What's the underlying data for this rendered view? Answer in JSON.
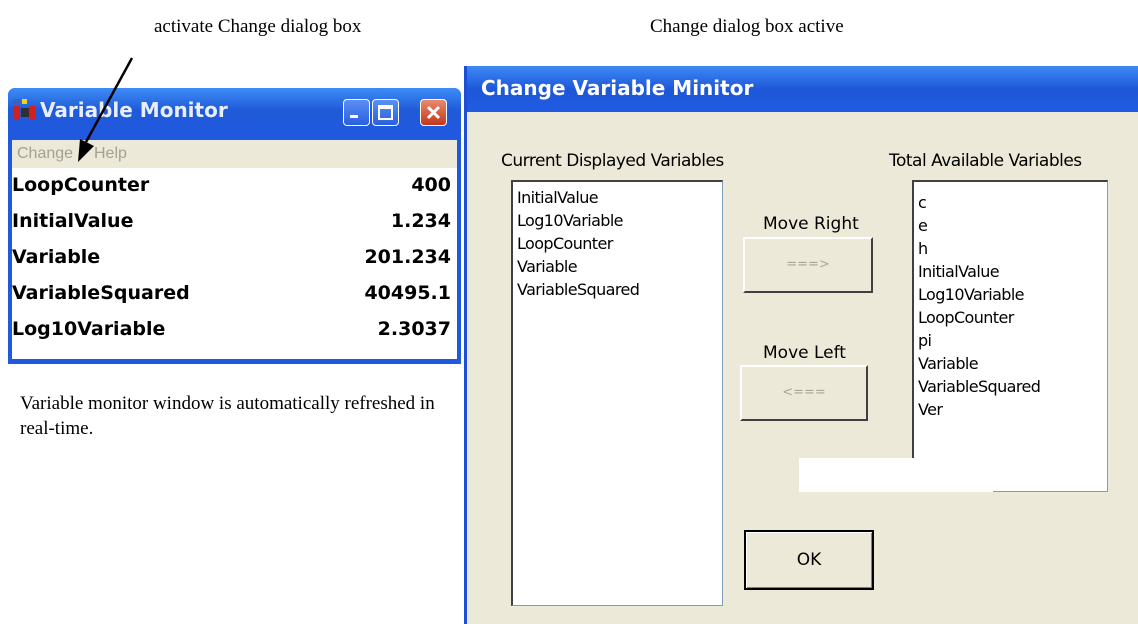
{
  "annotations": {
    "activate": "activate Change dialog box",
    "active": "Change dialog box active",
    "refresh": "Variable monitor window is automatically refreshed in real-time."
  },
  "monitor": {
    "title": "Variable Monitor",
    "menu": [
      "Change",
      "Help"
    ],
    "rows": [
      {
        "name": "LoopCounter",
        "value": "400"
      },
      {
        "name": "InitialValue",
        "value": "1.234"
      },
      {
        "name": "Variable",
        "value": "201.234"
      },
      {
        "name": "VariableSquared",
        "value": "40495.1"
      },
      {
        "name": "Log10Variable",
        "value": "2.3037"
      }
    ],
    "icons": {
      "app": "app-icon",
      "minimize": "minimize-icon",
      "maximize": "maximize-icon",
      "close": "close-icon"
    },
    "colors": {
      "titlebar": "#2058e0",
      "close": "#c2381d"
    }
  },
  "dialog": {
    "title": "Change Variable Minitor",
    "current_label": "Current Displayed Variables",
    "total_label": "Total Available Variables",
    "current_items": [
      "InitialValue",
      "Log10Variable",
      "LoopCounter",
      "Variable",
      "VariableSquared"
    ],
    "total_items": [
      "c",
      "e",
      "h",
      "InitialValue",
      "Log10Variable",
      "LoopCounter",
      "pi",
      "Variable",
      "VariableSquared",
      "Ver"
    ],
    "move_right_label": "Move Right",
    "move_right_button": "===>",
    "move_left_label": "Move Left",
    "move_left_button": "<===",
    "ok_label": "OK",
    "colors": {
      "background": "#ece9d8",
      "titlebar": "#205ae0"
    }
  }
}
